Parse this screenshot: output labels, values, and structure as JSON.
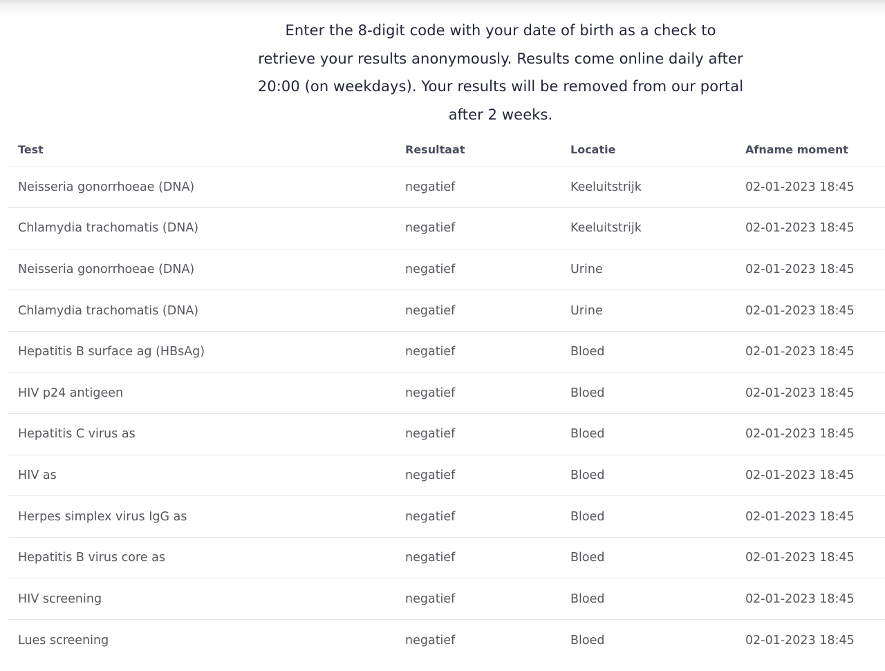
{
  "intro": {
    "text": "Enter the 8-digit code with your date of birth as a check to retrieve your results anonymously. Results come online daily after 20:00 (on weekdays). Your results will be removed from our portal after 2 weeks."
  },
  "table": {
    "headers": {
      "test": "Test",
      "result": "Resultaat",
      "location": "Locatie",
      "moment": "Afname moment"
    },
    "rows": [
      {
        "test": "Neisseria gonorrhoeae (DNA)",
        "result": "negatief",
        "location": "Keeluitstrijk",
        "moment": "02-01-2023 18:45"
      },
      {
        "test": "Chlamydia trachomatis (DNA)",
        "result": "negatief",
        "location": "Keeluitstrijk",
        "moment": "02-01-2023 18:45"
      },
      {
        "test": "Neisseria gonorrhoeae (DNA)",
        "result": "negatief",
        "location": "Urine",
        "moment": "02-01-2023 18:45"
      },
      {
        "test": "Chlamydia trachomatis (DNA)",
        "result": "negatief",
        "location": "Urine",
        "moment": "02-01-2023 18:45"
      },
      {
        "test": "Hepatitis B surface ag (HBsAg)",
        "result": "negatief",
        "location": "Bloed",
        "moment": "02-01-2023 18:45"
      },
      {
        "test": "HIV p24 antigeen",
        "result": "negatief",
        "location": "Bloed",
        "moment": "02-01-2023 18:45"
      },
      {
        "test": "Hepatitis C virus as",
        "result": "negatief",
        "location": "Bloed",
        "moment": "02-01-2023 18:45"
      },
      {
        "test": "HIV as",
        "result": "negatief",
        "location": "Bloed",
        "moment": "02-01-2023 18:45"
      },
      {
        "test": "Herpes simplex virus IgG as",
        "result": "negatief",
        "location": "Bloed",
        "moment": "02-01-2023 18:45"
      },
      {
        "test": "Hepatitis B virus core as",
        "result": "negatief",
        "location": "Bloed",
        "moment": "02-01-2023 18:45"
      },
      {
        "test": "HIV screening",
        "result": "negatief",
        "location": "Bloed",
        "moment": "02-01-2023 18:45"
      },
      {
        "test": "Lues screening",
        "result": "negatief",
        "location": "Bloed",
        "moment": "02-01-2023 18:45"
      }
    ]
  }
}
